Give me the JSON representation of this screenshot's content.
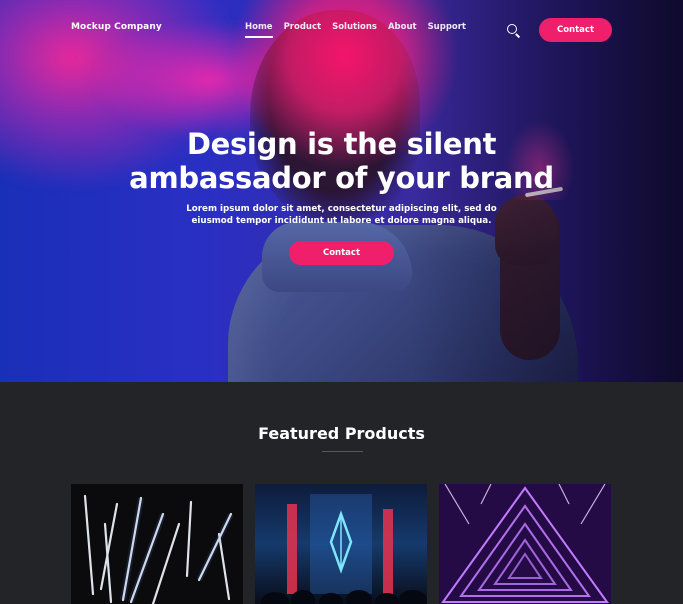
{
  "nav": {
    "brand": "Mockup Company",
    "items": [
      {
        "label": "Home",
        "active": true
      },
      {
        "label": "Product",
        "active": false
      },
      {
        "label": "Solutions",
        "active": false
      },
      {
        "label": "About",
        "active": false
      },
      {
        "label": "Support",
        "active": false
      }
    ],
    "search_icon": "search-icon",
    "contact_label": "Contact"
  },
  "hero": {
    "headline_line1": "Design is the silent",
    "headline_line2": "ambassador of your brand",
    "subtext_line1": "Lorem ipsum dolor sit amet, consectetur adipiscing elit, sed do",
    "subtext_line2": "eiusmod tempor incididunt ut labore et dolore magna aliqua.",
    "cta_label": "Contact"
  },
  "featured": {
    "title": "Featured Products",
    "cards": [
      {
        "name": "neon-light-sticks"
      },
      {
        "name": "neon-diamond-stage"
      },
      {
        "name": "purple-neon-tunnel"
      }
    ]
  },
  "colors": {
    "accent": "#ef1f6c",
    "section_bg": "#232427",
    "hero_blue": "#2a2fc4"
  }
}
